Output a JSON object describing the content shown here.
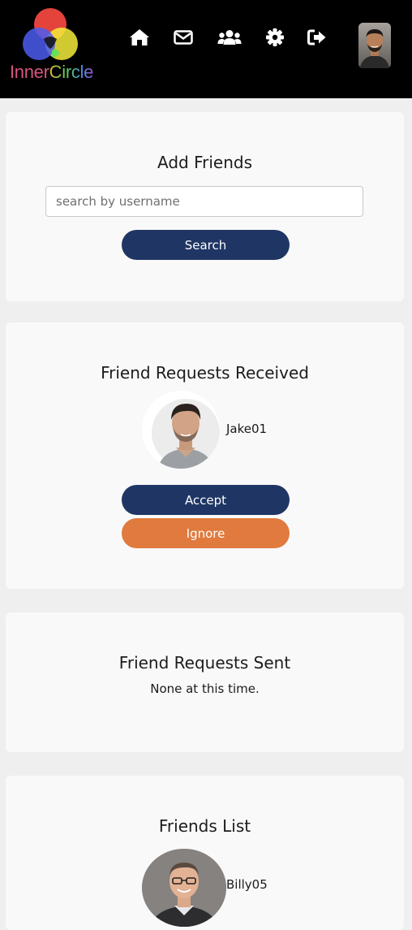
{
  "header": {
    "logo_text": {
      "part1": "Inner",
      "part2": "Circle"
    },
    "nav": {
      "home": "home-icon",
      "messages": "envelope-icon",
      "friends": "users-icon",
      "settings": "gear-icon",
      "logout": "sign-out-icon"
    },
    "colors": {
      "background": "#000000"
    }
  },
  "add_friends": {
    "title": "Add Friends",
    "search_placeholder": "search by username",
    "search_value": "",
    "search_button": "Search"
  },
  "requests_received": {
    "title": "Friend Requests Received",
    "items": [
      {
        "username": "Jake01",
        "accept_label": "Accept",
        "ignore_label": "Ignore"
      }
    ]
  },
  "requests_sent": {
    "title": "Friend Requests Sent",
    "empty_text": "None at this time."
  },
  "friends_list": {
    "title": "Friends List",
    "items": [
      {
        "username": "Billy05"
      }
    ]
  },
  "colors": {
    "page_bg": "#efefef",
    "card_bg": "#f9f9f9",
    "primary": "#1f3665",
    "secondary": "#e07a3e"
  }
}
